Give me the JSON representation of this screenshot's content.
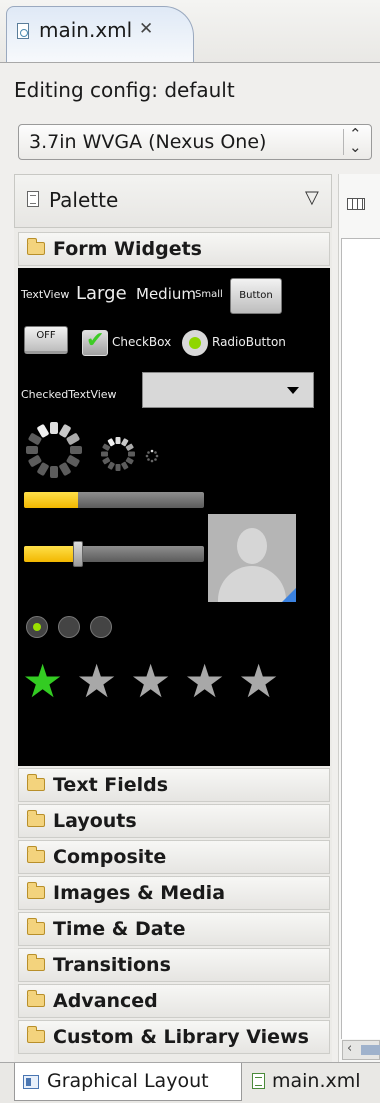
{
  "editor_tab": {
    "title": "main.xml",
    "close_glyph": "✕",
    "icon": "xml-file-icon"
  },
  "config": {
    "label": "Editing config: default",
    "device_value": "3.7in WVGA (Nexus One)",
    "arrows_glyph": "⌃⌄"
  },
  "palette": {
    "title": "Palette",
    "menu_glyph": "▽",
    "expanded_category": "Form Widgets",
    "categories": [
      "Text Fields",
      "Layouts",
      "Composite",
      "Images & Media",
      "Time & Date",
      "Transitions",
      "Advanced",
      "Custom & Library Views"
    ]
  },
  "widgets": {
    "textview": "TextView",
    "large": "Large",
    "medium": "Medium",
    "small": "Small",
    "button": "Button",
    "toggle": "OFF",
    "checkbox": "CheckBox",
    "radiobutton": "RadioButton",
    "checked_textview": "CheckedTextView",
    "progress_fraction": 0.3,
    "seekbar_fraction": 0.3,
    "rating_value": 1,
    "rating_max": 5,
    "colors": {
      "progress": "#f2b700",
      "star_on": "#33cc22",
      "star_off": "#a8a8a8"
    }
  },
  "bottom_tabs": [
    {
      "label": "Graphical Layout",
      "active": true
    },
    {
      "label": "main.xml",
      "active": false
    }
  ]
}
